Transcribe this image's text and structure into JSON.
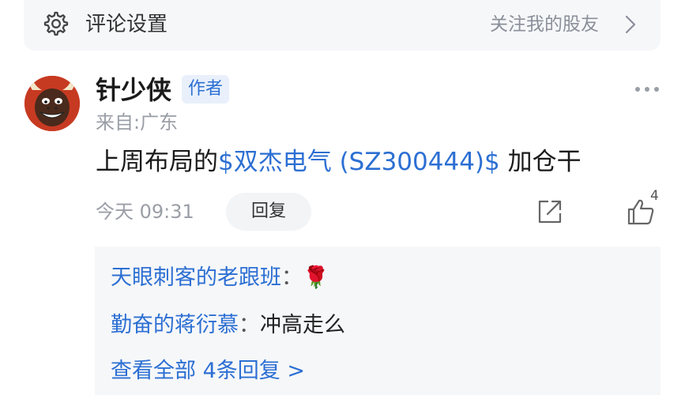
{
  "settings_bar": {
    "title": "评论设置",
    "follow_label": "关注我的股友"
  },
  "comment": {
    "username": "针少侠",
    "author_badge": "作者",
    "location": "来自:广东",
    "text_before": "上周布局的",
    "stock_tag": "$双杰电气 (SZ300444)$",
    "text_after": " 加仓干",
    "time": "今天 09:31",
    "reply_label": "回复",
    "like_count": "4"
  },
  "replies": [
    {
      "name": "天眼刺客的老跟班",
      "separator": "：",
      "text": "🌹"
    },
    {
      "name": "勤奋的蒋衍慕",
      "separator": "：",
      "text": "冲高走么"
    }
  ],
  "view_all_label": "查看全部 4条回复 >",
  "colors": {
    "link_blue": "#2c6fd3",
    "muted_gray": "#9a9ea6",
    "panel_bg": "#f6f7f9"
  }
}
